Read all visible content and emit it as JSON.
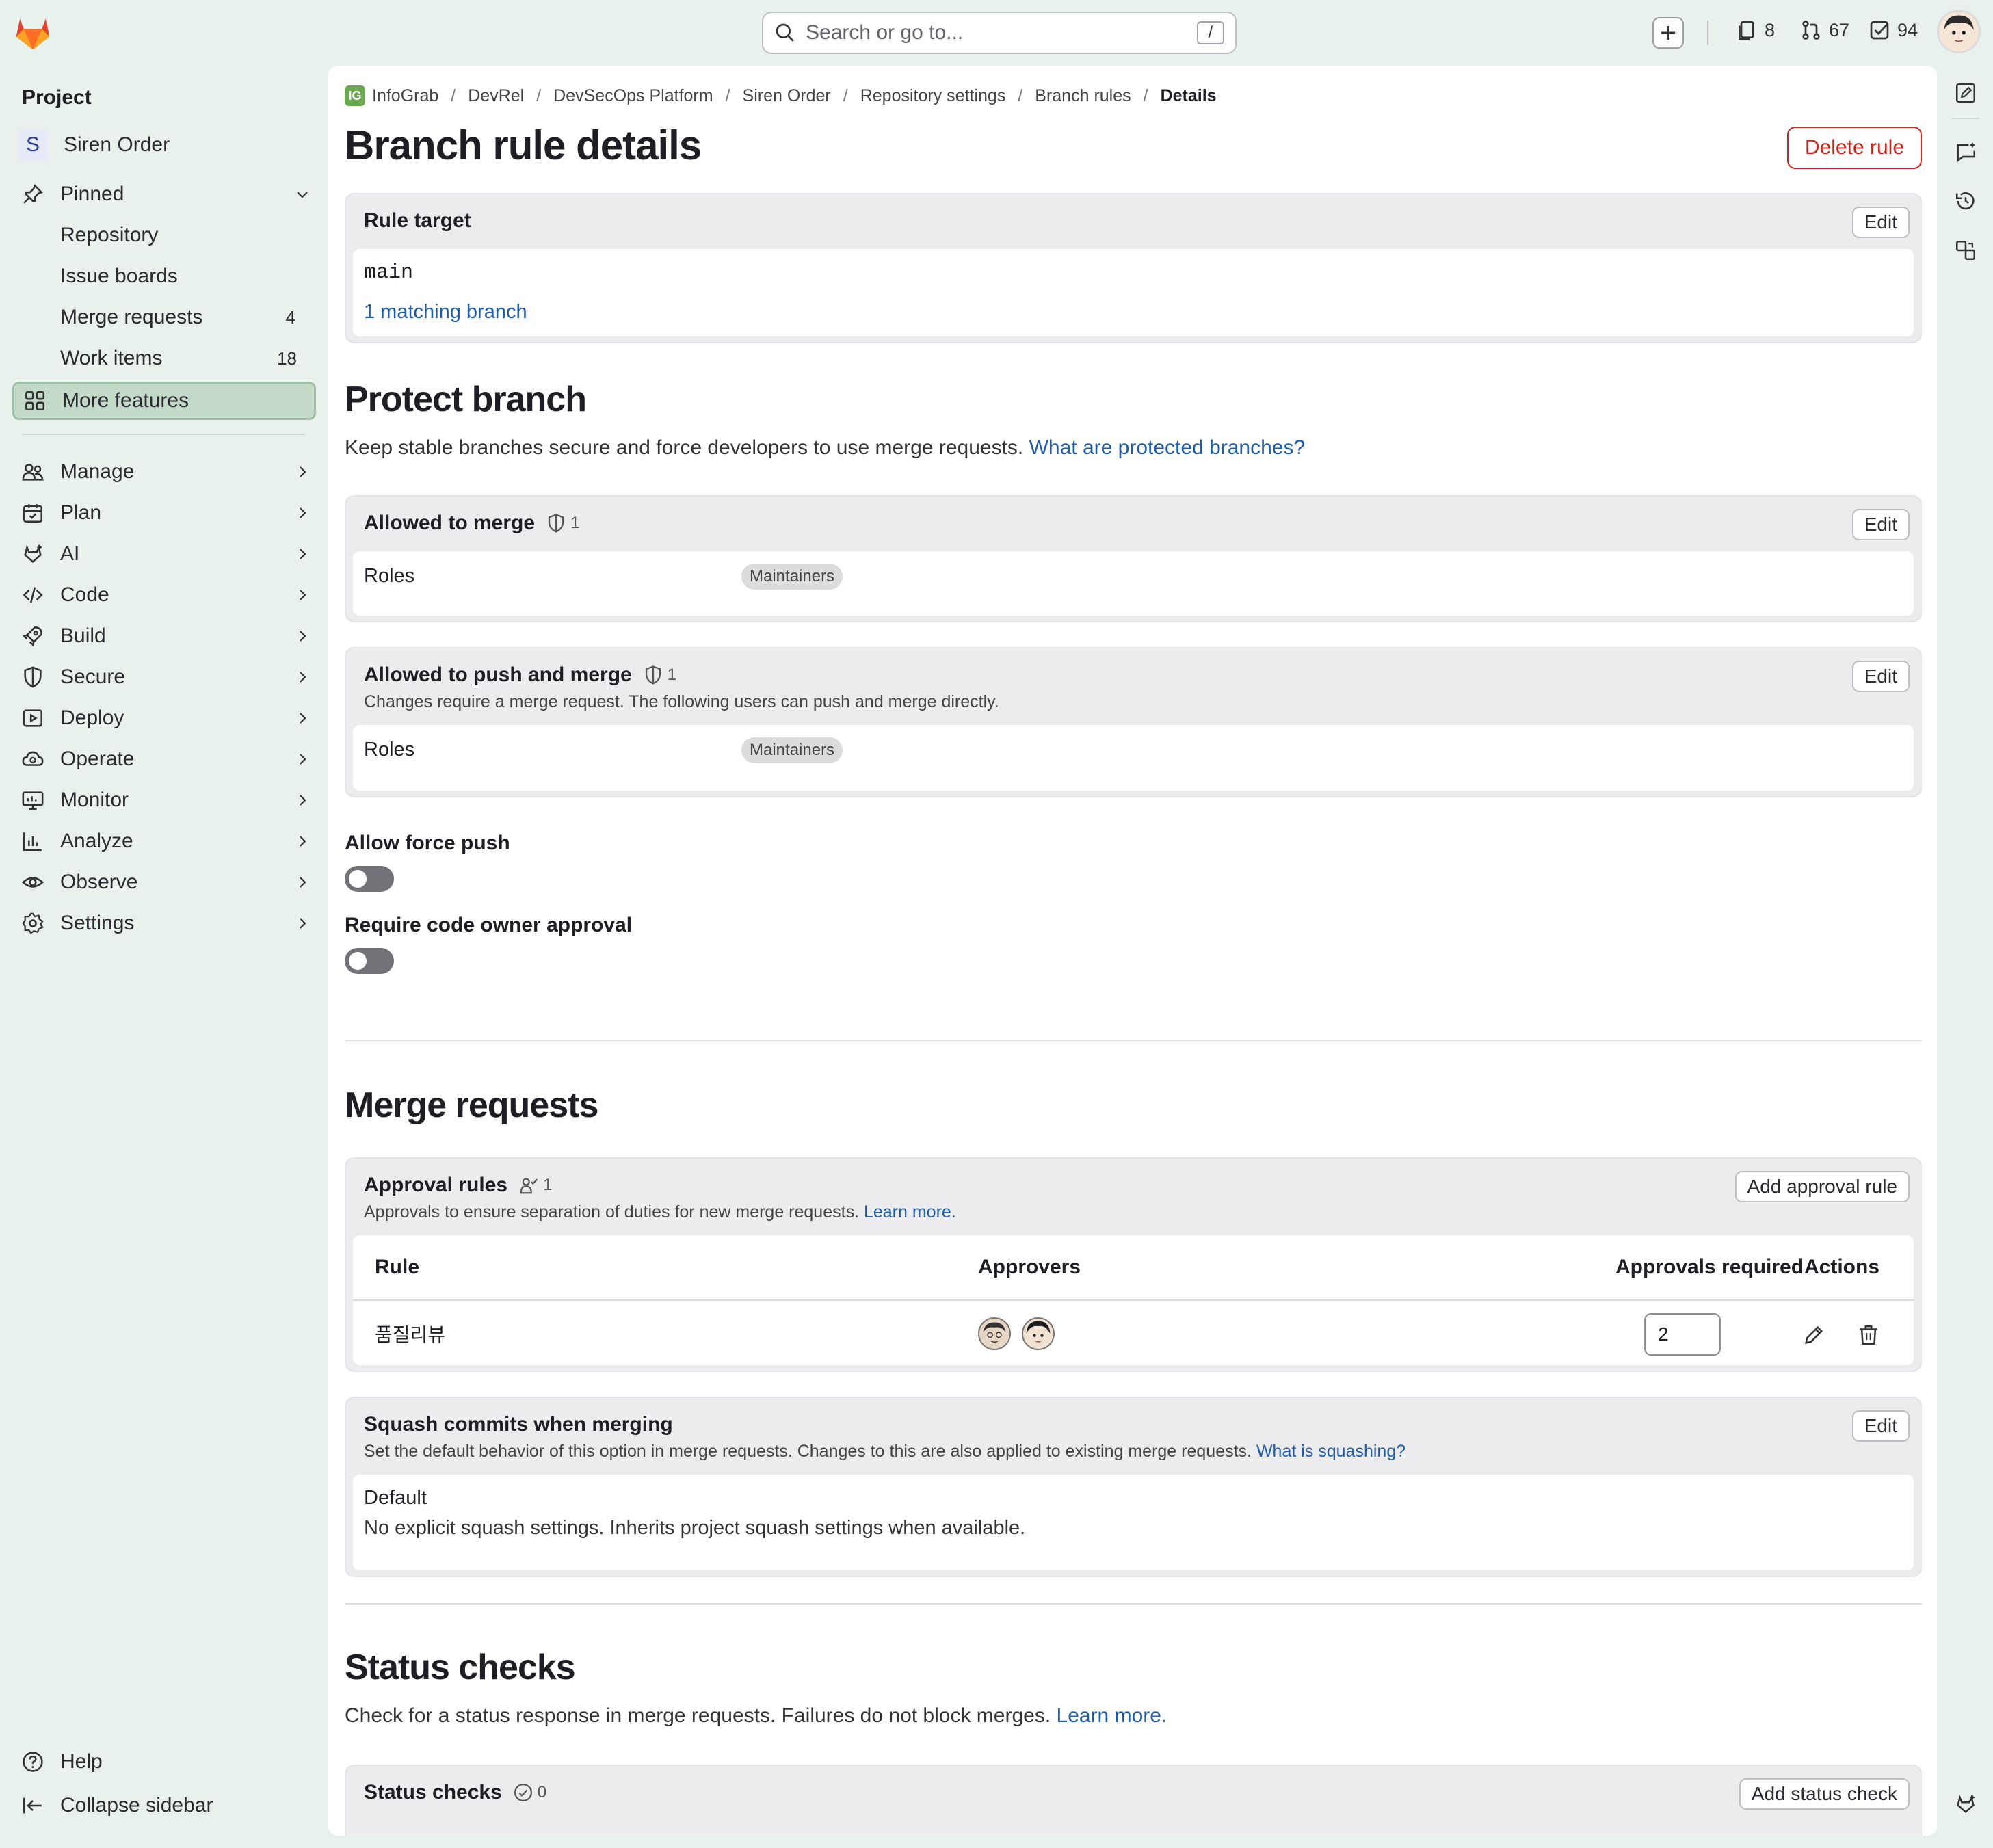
{
  "search": {
    "placeholder": "Search or go to...",
    "shortcut": "/"
  },
  "top_counts": {
    "issues": "8",
    "merge_requests": "67",
    "todos": "94"
  },
  "sidebar": {
    "title": "Project",
    "project_initial": "S",
    "project_name": "Siren Order",
    "pinned_label": "Pinned",
    "pinned_items": [
      {
        "label": "Repository",
        "count": ""
      },
      {
        "label": "Issue boards",
        "count": ""
      },
      {
        "label": "Merge requests",
        "count": "4"
      },
      {
        "label": "Work items",
        "count": "18"
      }
    ],
    "more_features": "More features",
    "sections": [
      "Manage",
      "Plan",
      "AI",
      "Code",
      "Build",
      "Secure",
      "Deploy",
      "Operate",
      "Monitor",
      "Analyze",
      "Observe",
      "Settings"
    ],
    "help": "Help",
    "collapse": "Collapse sidebar"
  },
  "breadcrumb": {
    "badge": "IG",
    "items": [
      "InfoGrab",
      "DevRel",
      "DevSecOps Platform",
      "Siren Order",
      "Repository settings",
      "Branch rules",
      "Details"
    ]
  },
  "page": {
    "title": "Branch rule details",
    "delete_button": "Delete rule"
  },
  "rule_target": {
    "title": "Rule target",
    "edit": "Edit",
    "branch": "main",
    "matching": "1 matching branch"
  },
  "protect_branch": {
    "title": "Protect branch",
    "description": "Keep stable branches secure and force developers to use merge requests.",
    "link": "What are protected branches?",
    "allowed_to_merge": {
      "title": "Allowed to merge",
      "count": "1",
      "edit": "Edit",
      "roles_label": "Roles",
      "role": "Maintainers"
    },
    "allowed_to_push": {
      "title": "Allowed to push and merge",
      "count": "1",
      "edit": "Edit",
      "description": "Changes require a merge request. The following users can push and merge directly.",
      "roles_label": "Roles",
      "role": "Maintainers"
    },
    "force_push": {
      "label": "Allow force push",
      "enabled": false
    },
    "code_owner": {
      "label": "Require code owner approval",
      "enabled": false
    }
  },
  "merge_requests": {
    "title": "Merge requests",
    "approval_rules": {
      "title": "Approval rules",
      "count": "1",
      "add_button": "Add approval rule",
      "description": "Approvals to ensure separation of duties for new merge requests.",
      "link": "Learn more.",
      "columns": [
        "Rule",
        "Approvers",
        "Approvals required",
        "Actions"
      ],
      "rows": [
        {
          "rule": "품질리뷰",
          "approvals_required": "2"
        }
      ]
    },
    "squash": {
      "title": "Squash commits when merging",
      "edit": "Edit",
      "description": "Set the default behavior of this option in merge requests. Changes to this are also applied to existing merge requests.",
      "link": "What is squashing?",
      "value_title": "Default",
      "value_desc": "No explicit squash settings. Inherits project squash settings when available."
    }
  },
  "status_checks": {
    "title": "Status checks",
    "description": "Check for a status response in merge requests. Failures do not block merges.",
    "link": "Learn more.",
    "card_title": "Status checks",
    "count": "0",
    "add_button": "Add status check"
  },
  "colors": {
    "accent_link": "#1f5da8",
    "danger": "#c9261b",
    "sidebar_bg": "#e9f1ec"
  }
}
